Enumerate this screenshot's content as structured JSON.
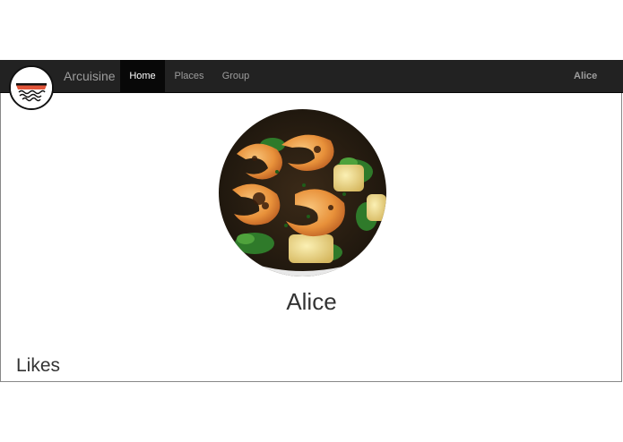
{
  "navbar": {
    "brand": "Arcuisine",
    "items": [
      {
        "label": "Home",
        "active": true
      },
      {
        "label": "Places",
        "active": false
      },
      {
        "label": "Group",
        "active": false
      }
    ],
    "user": "Alice"
  },
  "profile": {
    "name": "Alice",
    "photo_icon": "shrimp-dish-photo"
  },
  "sections": {
    "likes_title": "Likes"
  },
  "colors": {
    "navbar_bg": "#222222",
    "active_bg": "#080808",
    "nav_text": "#9d9d9d",
    "active_text": "#ffffff"
  }
}
